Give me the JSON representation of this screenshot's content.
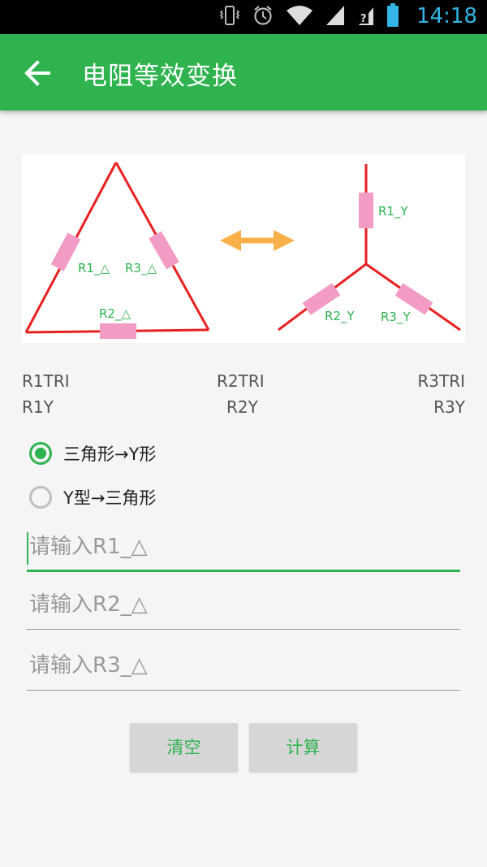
{
  "status_bar": {
    "time": "14:18",
    "icons": [
      "vibrate-icon",
      "alarm-icon",
      "wifi-icon",
      "signal-icon",
      "sim-unknown-icon",
      "battery-icon"
    ]
  },
  "app_bar": {
    "title": "电阻等效变换",
    "back_icon": "arrow-left-icon",
    "bg_color": "#2eb34f"
  },
  "diagram": {
    "delta_labels": [
      "R1_△",
      "R3_△",
      "R2_△"
    ],
    "y_labels": [
      "R1_Y",
      "R2_Y",
      "R3_Y"
    ],
    "wire_color": "#e82020",
    "resistor_color": "#f29bc4",
    "label_color": "#2eb34f",
    "arrow_color": "#f8b14a"
  },
  "results": {
    "tri": [
      "R1TRI",
      "R2TRI",
      "R3TRI"
    ],
    "y": [
      "R1Y",
      "R2Y",
      "R3Y"
    ]
  },
  "mode": {
    "options": [
      "三角形→Y形",
      "Y型→三角形"
    ],
    "selected_index": 0
  },
  "inputs": {
    "r1_placeholder": "请输入R1_△",
    "r2_placeholder": "请输入R2_△",
    "r3_placeholder": "请输入R3_△"
  },
  "buttons": {
    "clear": "清空",
    "calculate": "计算"
  }
}
